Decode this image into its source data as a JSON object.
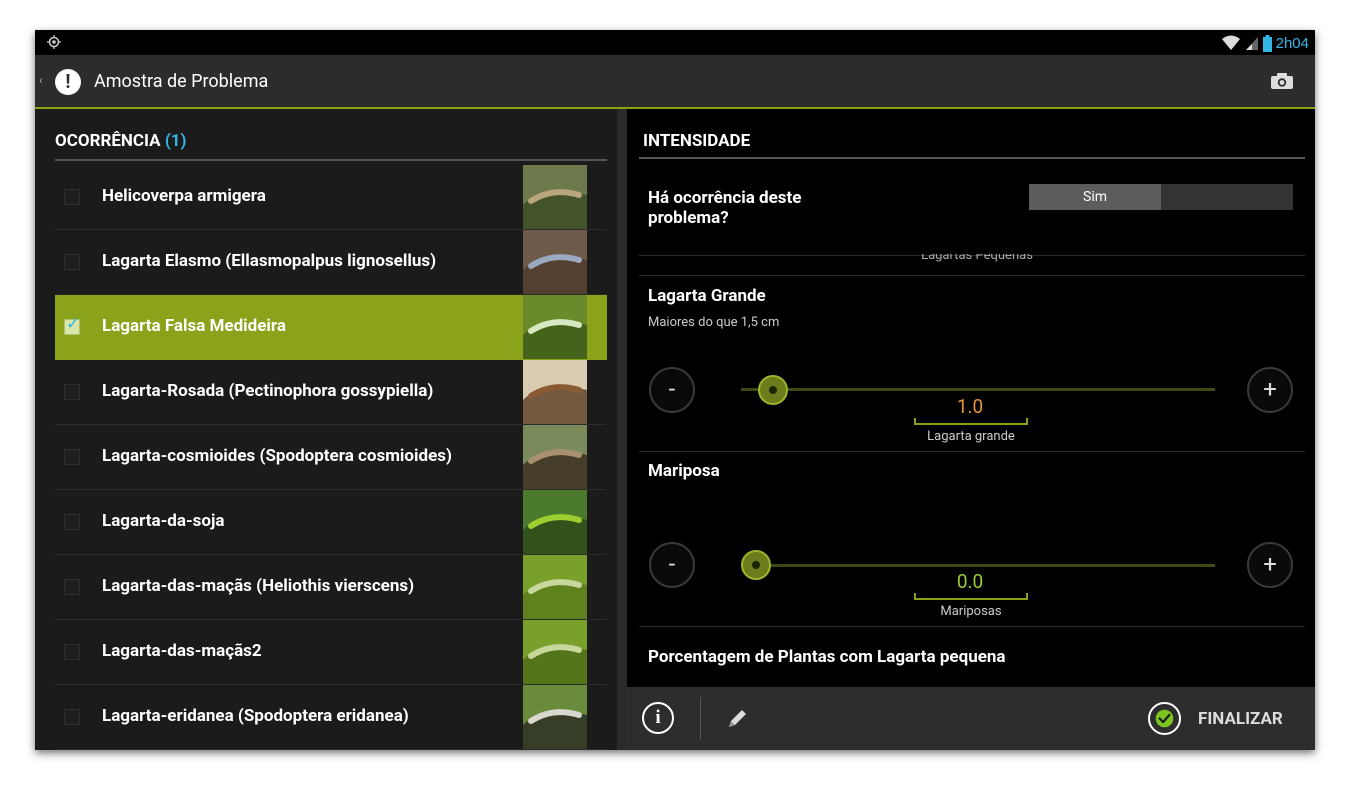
{
  "status_bar": {
    "time": "2h04"
  },
  "action_bar": {
    "title": "Amostra de Problema",
    "warn_glyph": "!",
    "up_glyph": "‹"
  },
  "left_panel": {
    "header_label": "OCORRÊNCIA",
    "header_count": "(1)",
    "items": [
      {
        "label": "Helicoverpa armigera",
        "checked": false,
        "thumb": "caterpillar-1"
      },
      {
        "label": "Lagarta Elasmo (Ellasmopalpus lignosellus)",
        "checked": false,
        "thumb": "caterpillar-2"
      },
      {
        "label": "Lagarta Falsa Medideira",
        "checked": true,
        "thumb": "caterpillar-3"
      },
      {
        "label": "Lagarta-Rosada (Pectinophora gossypiella)",
        "checked": false,
        "thumb": "caterpillar-4"
      },
      {
        "label": "Lagarta-cosmioides (Spodoptera cosmioides)",
        "checked": false,
        "thumb": "caterpillar-5"
      },
      {
        "label": "Lagarta-da-soja",
        "checked": false,
        "thumb": "caterpillar-6"
      },
      {
        "label": "Lagarta-das-maçãs (Heliothis vierscens)",
        "checked": false,
        "thumb": "caterpillar-7"
      },
      {
        "label": "Lagarta-das-maçãs2",
        "checked": false,
        "thumb": "caterpillar-8"
      },
      {
        "label": "Lagarta-eridanea (Spodoptera eridanea)",
        "checked": false,
        "thumb": "caterpillar-9"
      }
    ]
  },
  "right_panel": {
    "header": "INTENSIDADE",
    "occurrence_question": "Há ocorrência deste problema?",
    "occurrence_toggle": {
      "on_label": "Sim",
      "value": true
    },
    "partial_label": "Lagartas Pequenas",
    "sliders": [
      {
        "title": "Lagarta Grande",
        "subtitle": "Maiores do que 1,5 cm",
        "value": "1.0",
        "unit_label": "Lagarta grande",
        "value_color": "#e8923a",
        "position_fraction": 0.035
      },
      {
        "title": "Mariposa",
        "subtitle": "",
        "value": "0.0",
        "unit_label": "Mariposas",
        "value_color": "#9acd32",
        "position_fraction": 0.0
      }
    ],
    "next_section_title": "Porcentagem de Plantas com Lagarta pequena",
    "minus_glyph": "-",
    "plus_glyph": "+"
  },
  "bottom_bar": {
    "info_glyph": "i",
    "finish_label": "FINALIZAR"
  },
  "colors": {
    "accent": "#8aa316",
    "selected_row": "#8aa31a",
    "count_blue": "#33b5e5"
  }
}
